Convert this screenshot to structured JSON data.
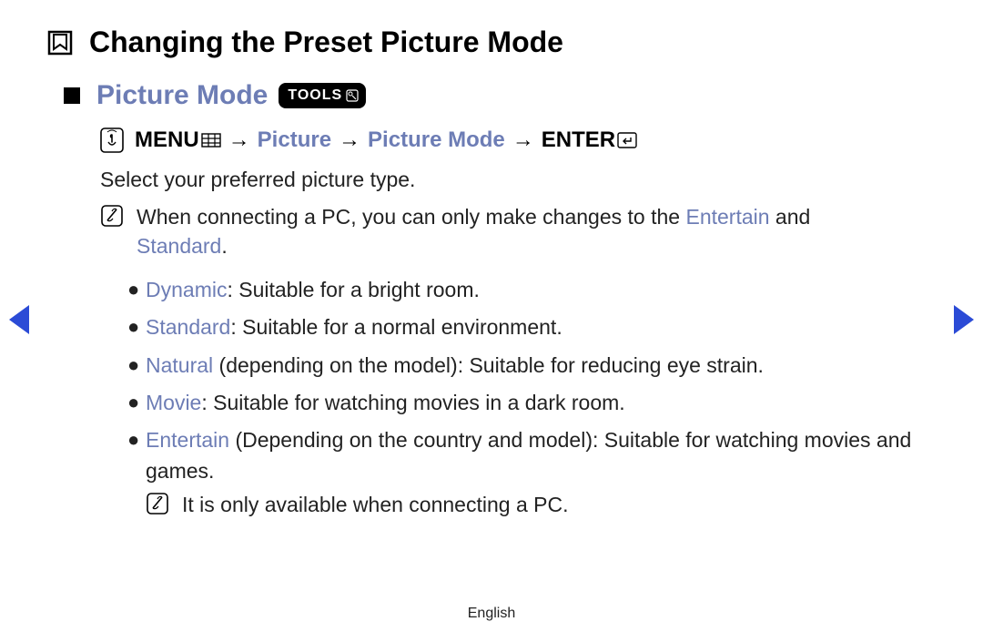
{
  "header": {
    "title": "Changing the Preset Picture Mode"
  },
  "subhead": {
    "title": "Picture Mode",
    "tools_label": "TOOLS"
  },
  "nav_path": {
    "menu_label": "MENU",
    "step1": "Picture",
    "step2": "Picture Mode",
    "enter_label": "ENTER",
    "arrow": "→"
  },
  "intro": "Select your preferred picture type.",
  "note1_pre": "When connecting a PC, you can only make changes to the ",
  "note1_hl1": "Entertain",
  "note1_mid": " and ",
  "note1_hl2": "Standard",
  "note1_post": ".",
  "bullets": [
    {
      "name": "Dynamic",
      "desc": ": Suitable for a bright room."
    },
    {
      "name": "Standard",
      "desc": ": Suitable for a normal environment."
    },
    {
      "name": "Natural",
      "paren": " (depending on the model)",
      "desc": ": Suitable for reducing eye strain."
    },
    {
      "name": "Movie",
      "desc": ": Suitable for watching movies in a dark room."
    },
    {
      "name": "Entertain",
      "paren": " (Depending on the country and model)",
      "desc": ": Suitable for watching movies and games.",
      "subnote": "It is only available when connecting a PC."
    }
  ],
  "footer": {
    "language": "English"
  }
}
